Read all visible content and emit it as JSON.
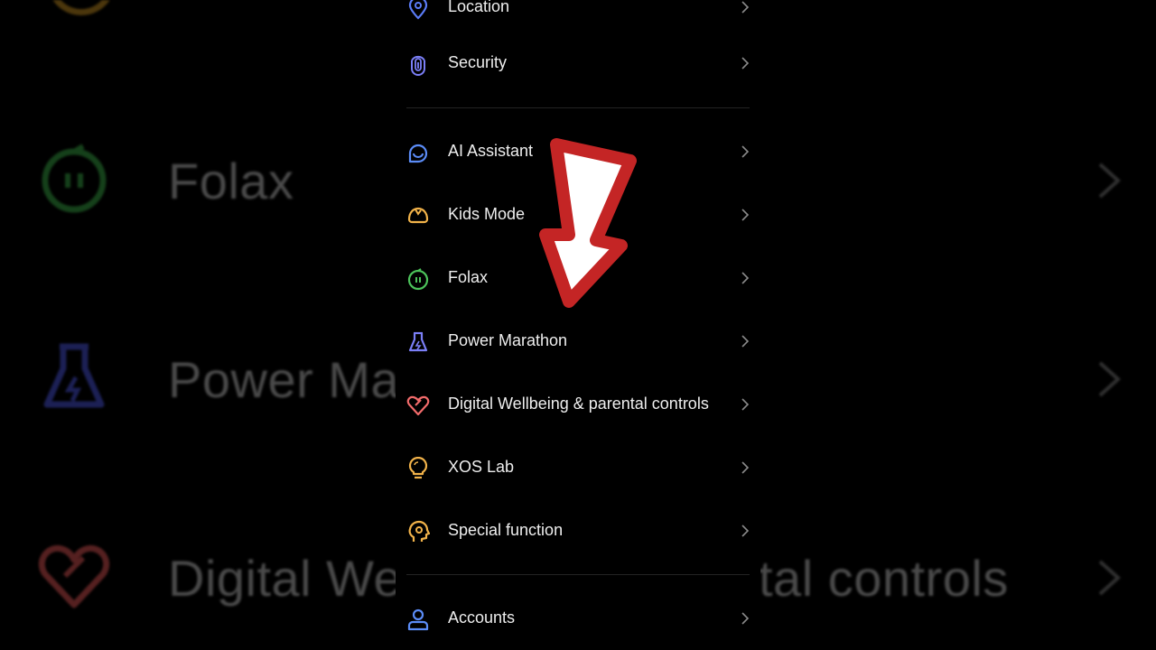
{
  "colors": {
    "background": "#000000",
    "text": "#eeeeee",
    "chevron": "#8a8a8a",
    "divider": "#232323",
    "annotation_red": "#c42525"
  },
  "background_overlay": {
    "rows": [
      {
        "label": "Folax",
        "icon": "folax-icon",
        "color": "#38a845"
      },
      {
        "label": "Power Ma",
        "icon": "power-marathon-icon",
        "color": "#4a55e0"
      },
      {
        "label": "Digital We",
        "tail": "tal controls",
        "icon": "heart-icon",
        "color": "#e05555"
      }
    ]
  },
  "settings": {
    "items": [
      {
        "label": "Location",
        "icon": "location-icon",
        "color": "#5b7cf7"
      },
      {
        "label": "Security",
        "icon": "fingerprint-icon",
        "color": "#7b7ff7"
      },
      {
        "label": "AI Assistant",
        "icon": "ai-assistant-icon",
        "color": "#5b8cf7"
      },
      {
        "label": "Kids Mode",
        "icon": "kids-mode-icon",
        "color": "#f2b34a"
      },
      {
        "label": "Folax",
        "icon": "folax-icon",
        "color": "#4cc25a"
      },
      {
        "label": "Power Marathon",
        "icon": "power-marathon-icon",
        "color": "#7b7ff7"
      },
      {
        "label": "Digital Wellbeing & parental controls",
        "icon": "heart-icon",
        "color": "#f26b6b"
      },
      {
        "label": "XOS Lab",
        "icon": "lightbulb-icon",
        "color": "#f2b34a"
      },
      {
        "label": "Special function",
        "icon": "special-function-icon",
        "color": "#f2b34a"
      },
      {
        "label": "Accounts",
        "icon": "account-icon",
        "color": "#5b8cf7"
      }
    ]
  }
}
